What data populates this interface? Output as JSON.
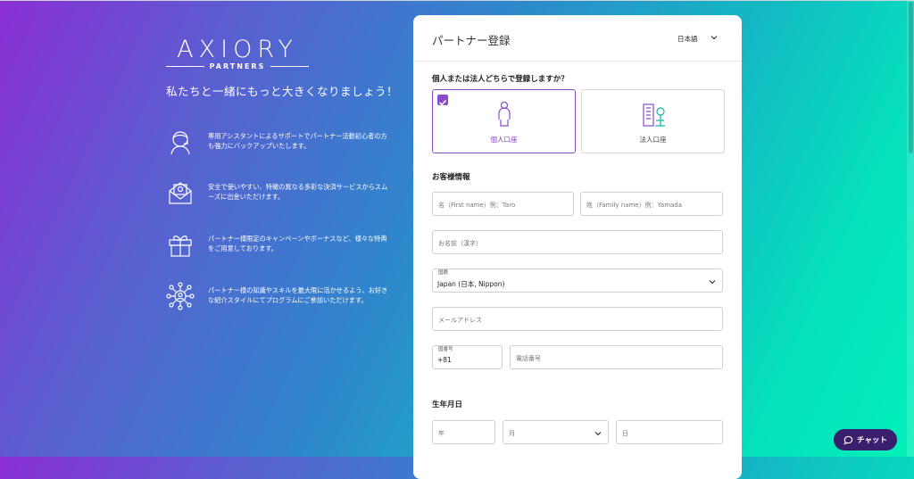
{
  "brand": {
    "name": "AXIORY",
    "sub": "PARTNERS"
  },
  "tagline": "私たちと一緒にもっと大きくなりましょう！",
  "features": [
    {
      "icon": "support-agent-icon",
      "text": "専用アシスタントによるサポートでパートナー活動初心者の方も強力にバックアップいたします。"
    },
    {
      "icon": "money-envelope-icon",
      "text": "安全で使いやすい、特徴の異なる多彩な決済サービスからスムーズに出金いただけます。"
    },
    {
      "icon": "gift-icon",
      "text": "パートナー様限定のキャンペーンやボーナスなど、様々な特典をご用意しております。"
    },
    {
      "icon": "network-people-icon",
      "text": "パートナー様の知識やスキルを最大限に活かせるよう、お好きな紹介スタイルにてプログラムにご参加いただけます。"
    }
  ],
  "form": {
    "title": "パートナー登録",
    "language": "日本語",
    "account_question": "個人または法人どちらで登録しますか？",
    "account_types": [
      {
        "label": "個人口座",
        "selected": true
      },
      {
        "label": "法人口座",
        "selected": false
      }
    ],
    "customer_info_label": "お客様情報",
    "first_name_placeholder": "名（First name）例：Taro",
    "last_name_placeholder": "姓（Family name）例：Yamada",
    "kanji_name_placeholder": "お名前（漢字）",
    "country_label": "国籍",
    "country_value": "Japan (日本, Nippon)",
    "email_placeholder": "メールアドレス",
    "country_code_label": "国番号",
    "country_code_value": "+81",
    "phone_placeholder": "電話番号",
    "birthdate_label": "生年月日",
    "year_placeholder": "年",
    "month_placeholder": "月",
    "day_placeholder": "日"
  },
  "chat": {
    "label": "チャット"
  },
  "colors": {
    "accent": "#8a4bc9",
    "chat_bg": "#3a1f6e"
  }
}
